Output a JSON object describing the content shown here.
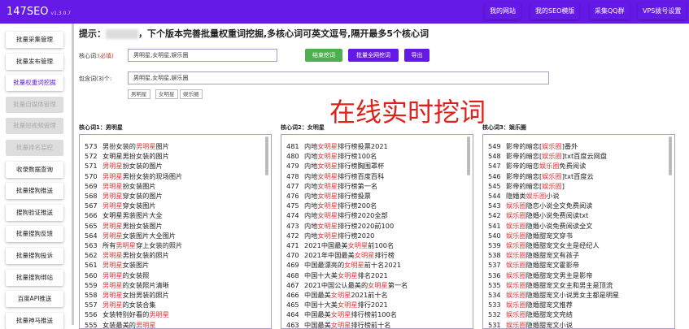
{
  "header": {
    "logo": "147SEO",
    "version": "v1.3.0.7",
    "nav": [
      "我的网站",
      "我的SEO模版",
      "采集QQ群",
      "VPS拨号设置"
    ]
  },
  "sidebar": [
    {
      "label": "批量采集管理",
      "state": "normal"
    },
    {
      "label": "批量发布管理",
      "state": "normal"
    },
    {
      "label": "批量权重词挖掘",
      "state": "active"
    },
    {
      "label": "批量自媒体管理",
      "state": "disabled"
    },
    {
      "label": "批量短视频管理",
      "state": "disabled"
    },
    {
      "label": "批量排名监控",
      "state": "disabled"
    },
    {
      "label": "收录数据查询",
      "state": "normal"
    },
    {
      "label": "批量搜狗推送",
      "state": "normal"
    },
    {
      "label": "搜狗验证推送",
      "state": "normal"
    },
    {
      "label": "批量搜狗反馈",
      "state": "normal"
    },
    {
      "label": "批量搜狗投诉",
      "state": "normal"
    },
    {
      "label": "批量搜狗绑站",
      "state": "normal"
    },
    {
      "label": "百度API推送",
      "state": "normal"
    },
    {
      "label": "批量神马推送",
      "state": "normal"
    }
  ],
  "tip": {
    "prefix": "提示：",
    "text": "，下个版本完善批量权重词挖掘,多核心词可英文逗号,隔开最多5个核心词"
  },
  "form": {
    "core_label": "核心词:",
    "required": "(必填)",
    "core_value": "男明星,女明星,娱乐圈",
    "stop_btn": "结束挖词",
    "batch_btn": "批量全网挖词",
    "export_btn": "导出",
    "include_label": "包含词(3)个:",
    "include_value": "男明星,女明星,娱乐圈",
    "tags": [
      "男明星",
      "女明星",
      "娱乐圈"
    ]
  },
  "banner": "在线实时挖词",
  "colors": {
    "brand": "#6419e6",
    "green": "#4caf50",
    "keyword": "#e03a3a"
  },
  "columns": [
    {
      "title": "核心词1：男明星",
      "kw": "男明星",
      "rows": [
        [
          573,
          "男扮女装的男明星图片"
        ],
        [
          572,
          "女明星男扮女装的图片"
        ],
        [
          571,
          "男明星扮女装的图片"
        ],
        [
          570,
          "男明星男扮女装的现场图片"
        ],
        [
          569,
          "男明星扮女装图片"
        ],
        [
          568,
          "男明星穿女装的图片"
        ],
        [
          567,
          "男明星穿女装图片"
        ],
        [
          566,
          "女明星男装图片大全"
        ],
        [
          565,
          "男明星男扮女装图片"
        ],
        [
          564,
          "男明星女装图片大全图片"
        ],
        [
          563,
          "所有男明星穿上女装的照片"
        ],
        [
          562,
          "男明星男扮女装的照片"
        ],
        [
          561,
          "男明星女装图片"
        ],
        [
          560,
          "男明星的女装照"
        ],
        [
          559,
          "男明星的女装照片清晰"
        ],
        [
          558,
          "男明星女扮男装的照片"
        ],
        [
          557,
          "男明星的女装合集"
        ],
        [
          556,
          "女装特别好看的男明星"
        ],
        [
          555,
          "女装最美的男明星"
        ]
      ]
    },
    {
      "title": "核心词2：女明星",
      "kw": "女明星",
      "rows": [
        [
          481,
          "内地女明星排行榜投票2021"
        ],
        [
          480,
          "内地女明星排行榜100名"
        ],
        [
          479,
          "内地女明星排行榜胸围罩杯"
        ],
        [
          478,
          "内地女明星排行榜百度百科"
        ],
        [
          477,
          "内地女明星排行榜第一名"
        ],
        [
          476,
          "内地女明星排行榜投票"
        ],
        [
          475,
          "内地女明星排行榜200名"
        ],
        [
          474,
          "内地女明星排行榜2020全部"
        ],
        [
          473,
          "内地女明星排行榜2020前100"
        ],
        [
          472,
          "内地女明星排行榜2020"
        ],
        [
          471,
          "2021中国最美女明星前100名"
        ],
        [
          470,
          "2021年中国最美女明星排行榜"
        ],
        [
          469,
          "中国最漂亮的女明星前十名2021"
        ],
        [
          468,
          "中国十大美女明星排名2021"
        ],
        [
          467,
          "2021中国公认最美的女明星第一名"
        ],
        [
          466,
          "中国最美女明星2021前十名"
        ],
        [
          465,
          "中国十大美女明星排行2021"
        ],
        [
          464,
          "中国最美女明星排行榜前100名"
        ],
        [
          463,
          "中国最美女明星排行榜前十名"
        ]
      ]
    },
    {
      "title": "核心词3：娱乐圈",
      "kw": "娱乐圈",
      "rows": [
        [
          549,
          "影帝的暗恋[娱乐圈]番外"
        ],
        [
          548,
          "影帝的暗恋[娱乐圈]txt百度云网盘"
        ],
        [
          547,
          "影帝的暗恋娱乐圈免费阅读"
        ],
        [
          546,
          "影帝的暗恋[娱乐圈]txt百度云"
        ],
        [
          545,
          "影帝的暗恋[娱乐圈]"
        ],
        [
          544,
          "隐婚类娱乐圈小说"
        ],
        [
          543,
          "娱乐圈隐恋小说全文免费阅读"
        ],
        [
          542,
          "娱乐圈隐婚小说免费阅读txt"
        ],
        [
          541,
          "娱乐圈隐婚小说免费阅读全文"
        ],
        [
          540,
          "娱乐圈隐婚甜宠文穿书"
        ],
        [
          539,
          "娱乐圈隐婚甜宠文女主是经纪人"
        ],
        [
          538,
          "娱乐圈隐婚甜宠文有孩子"
        ],
        [
          537,
          "娱乐圈隐婚甜宠文霍影帝"
        ],
        [
          536,
          "娱乐圈隐婚甜宠文男主是影帝"
        ],
        [
          535,
          "娱乐圈隐婚甜宠文女主和男主是顶流"
        ],
        [
          534,
          "娱乐圈隐婚甜宠文小说男女主都是明星"
        ],
        [
          533,
          "娱乐圈隐婚甜宠文推荐"
        ],
        [
          532,
          "娱乐圈隐婚甜宠文完结"
        ],
        [
          531,
          "娱乐圈隐婚甜宠文小说"
        ]
      ]
    }
  ]
}
